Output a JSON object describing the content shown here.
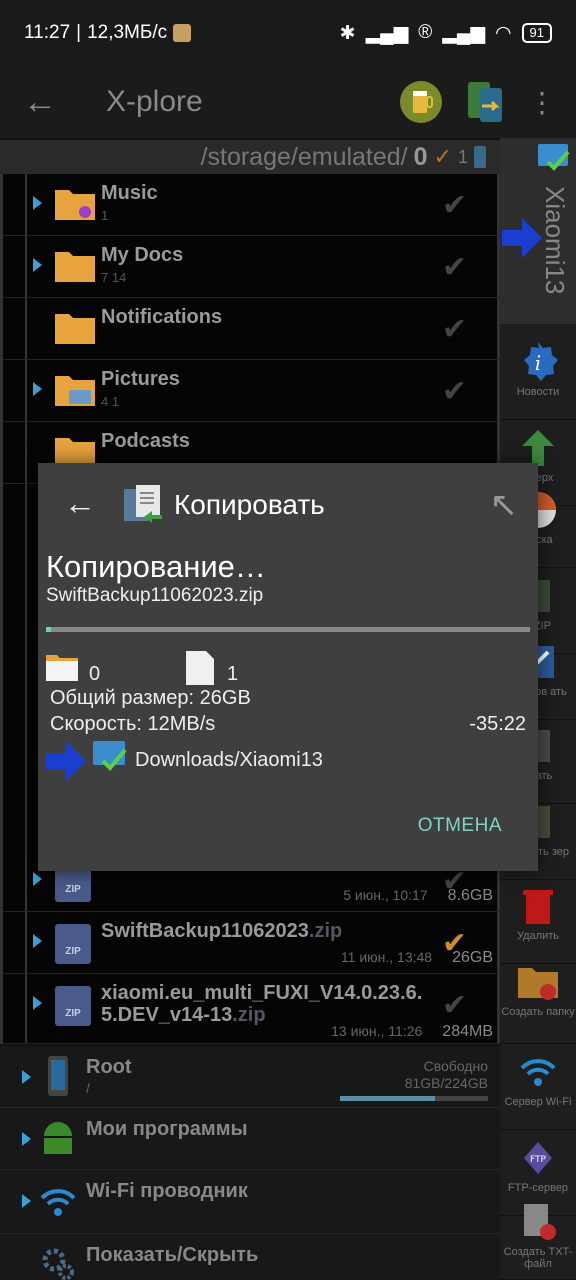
{
  "status_bar": {
    "time": "11:27",
    "speed": "12,3МБ/с",
    "battery": "91"
  },
  "app_bar": {
    "title": "X-plore"
  },
  "path": {
    "text": "/storage/emulated/",
    "bold": "0",
    "count": "1"
  },
  "files": [
    {
      "name": "Music",
      "meta": "1"
    },
    {
      "name": "My Docs",
      "meta": "7   14"
    },
    {
      "name": "Notifications",
      "meta": ""
    },
    {
      "name": "Pictures",
      "meta": "4   1"
    },
    {
      "name": "Podcasts",
      "meta": ""
    }
  ],
  "zip_rows": [
    {
      "name": "",
      "ext": "",
      "date": "5 июн., 10:17",
      "size": "8.6GB"
    },
    {
      "name": "SwiftBackup11062023",
      "ext": ".zip",
      "date": "11 июн., 13:48",
      "size": "26GB"
    },
    {
      "name": "xiaomi.eu_multi_FUXI_V14.0.23.6.",
      "name2": "5.DEV_v14-13",
      "ext": ".zip",
      "date": "13 июн., 11:26",
      "size": "284MB"
    }
  ],
  "side_panel": {
    "device": "Xiaomi13",
    "items": [
      "Новости",
      "Вверх",
      "диска",
      "ь ZIP",
      "еменов\nать",
      "овать",
      "Создать\nзер",
      "Удалить",
      "Создать\nпапку",
      "Сервер Wi-Fi",
      "FTP-сервер",
      "Создать\nTXT-файл"
    ]
  },
  "bottom": {
    "root_label": "Root",
    "root_sub": "/",
    "free_label": "Свободно",
    "free_value": "81GB/224GB",
    "usage_fraction": 0.64,
    "apps": "Мои программы",
    "wifi": "Wi-Fi проводник",
    "show_hide": "Показать/Скрыть"
  },
  "dialog": {
    "title": "Копировать",
    "status": "Копирование…",
    "file": "SwiftBackup11062023.zip",
    "progress_fraction": 0.01,
    "folders": "0",
    "files": "1",
    "total": "Общий размер: 26GB",
    "speed": "Скорость: 12MB/s",
    "remaining": "-35:22",
    "destination": "Downloads/Xiaomi13",
    "cancel": "ОТМЕНА"
  },
  "colors": {
    "accent": "#7fd3c8",
    "arrow": "#3aa0d8",
    "dialog_bg": "#3f3f3f"
  }
}
